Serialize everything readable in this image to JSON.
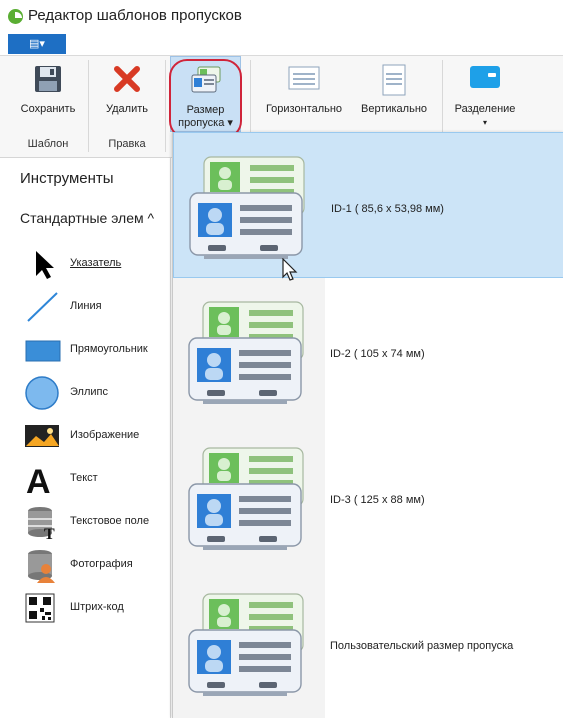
{
  "window": {
    "title": "Редактор шаблонов пропусков"
  },
  "menu": {
    "file_label": "▤▾"
  },
  "ribbon": {
    "save_label": "Сохранить",
    "delete_label": "Удалить",
    "size_label_1": "Размер",
    "size_label_2": "пропуска ▾",
    "horizontal_label": "Горизонтально",
    "vertical_label": "Вертикально",
    "split_label": "Разделение",
    "split_arrow": "▾",
    "group_template": "Шаблон",
    "group_edit": "Правка"
  },
  "tools_panel": {
    "title": "Инструменты",
    "section": "Стандартные элем ^",
    "items": [
      {
        "label": "Указатель",
        "icon": "pointer-icon"
      },
      {
        "label": "Линия",
        "icon": "line-icon"
      },
      {
        "label": "Прямоугольник",
        "icon": "rectangle-icon"
      },
      {
        "label": "Эллипс",
        "icon": "ellipse-icon"
      },
      {
        "label": "Изображение",
        "icon": "image-icon"
      },
      {
        "label": "Текст",
        "icon": "text-icon"
      },
      {
        "label": "Текстовое поле",
        "icon": "text-field-icon"
      },
      {
        "label": "Фотография",
        "icon": "photo-icon"
      },
      {
        "label": "Штрих-код",
        "icon": "barcode-icon"
      }
    ]
  },
  "size_menu": {
    "items": [
      {
        "label": "ID-1 ( 85,6 x 53,98 мм)"
      },
      {
        "label": "ID-2 ( 105 x 74 мм)"
      },
      {
        "label": "ID-3 ( 125 x 88 мм)"
      },
      {
        "label": "Пользовательский размер пропуска"
      }
    ]
  },
  "colors": {
    "accent": "#1e6fc4",
    "selected": "#cce4f7",
    "highlight": "#d0243a"
  }
}
